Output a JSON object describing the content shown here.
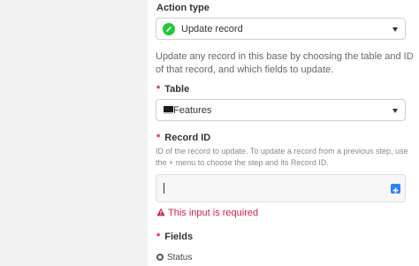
{
  "action_type": {
    "heading": "Action type",
    "selected": "Update record",
    "icon": "pencil-icon",
    "icon_color": "#20c933",
    "description": "Update any record in this base by choosing the table and ID of that record, and which fields to update."
  },
  "table": {
    "required_marker": "*",
    "label": "Table",
    "selected": "Features",
    "icon": "table-icon"
  },
  "record_id": {
    "required_marker": "*",
    "label": "Record ID",
    "help": "ID of the record to update. To update a record from a previous step, use the + menu to choose the step and its Record ID.",
    "value": "",
    "add_icon": "plus-icon",
    "add_icon_color": "#2d7ff9",
    "error_icon": "warning-icon",
    "error": "This input is required",
    "error_color": "#d0204b"
  },
  "fields": {
    "required_marker": "*",
    "label": "Fields",
    "items": [
      {
        "label": "Status",
        "icon": "status-icon"
      }
    ]
  }
}
